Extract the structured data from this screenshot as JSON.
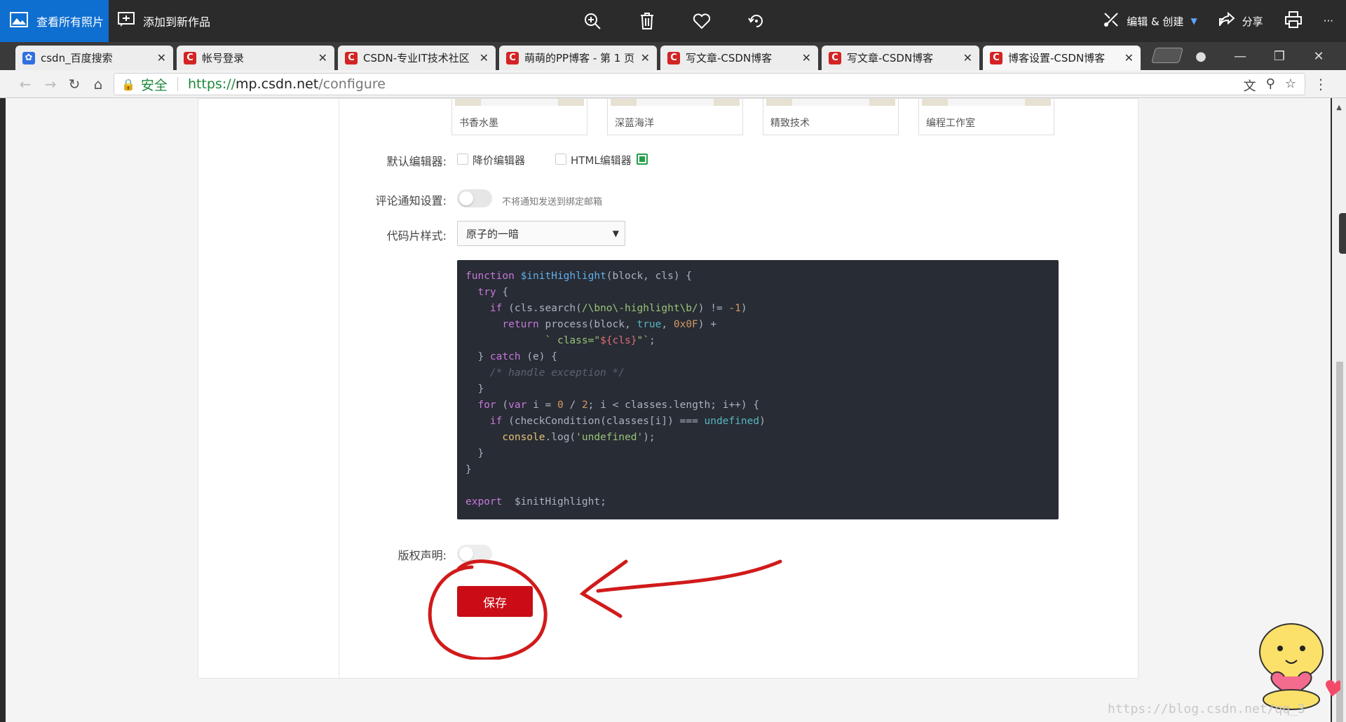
{
  "photos_app": {
    "view_all_label": "查看所有照片",
    "add_to_creation_label": "添加到新作品",
    "edit_create_label": "编辑 & 创建",
    "share_label": "分享",
    "more_label": "···"
  },
  "browser": {
    "tabs": [
      {
        "title": "csdn_百度搜索",
        "favicon": "baidu"
      },
      {
        "title": "帐号登录",
        "favicon": "csdn"
      },
      {
        "title": "CSDN-专业IT技术社区",
        "favicon": "csdn"
      },
      {
        "title": "萌萌的PP博客 - 第 1 页",
        "favicon": "csdn"
      },
      {
        "title": "写文章-CSDN博客",
        "favicon": "csdn"
      },
      {
        "title": "写文章-CSDN博客",
        "favicon": "csdn"
      },
      {
        "title": "博客设置-CSDN博客",
        "favicon": "csdn",
        "active": true
      }
    ],
    "secure_label": "安全",
    "url": {
      "scheme": "https://",
      "host": "mp.csdn.net",
      "path": "/configure"
    }
  },
  "settings": {
    "themes": [
      "书香水墨",
      "深蓝海洋",
      "精致技术",
      "编程工作室"
    ],
    "default_editor": {
      "label": "默认编辑器:",
      "options": [
        "降价编辑器",
        "HTML编辑器"
      ]
    },
    "comment_notify": {
      "label": "评论通知设置:",
      "hint": "不将通知发送到绑定邮箱",
      "on": false
    },
    "code_style": {
      "label": "代码片样式:",
      "selected": "原子的一暗"
    },
    "copyright": {
      "label": "版权声明:",
      "on": false
    },
    "save_label": "保存"
  },
  "watermark": "https://blog.csdn.net/qq_3"
}
